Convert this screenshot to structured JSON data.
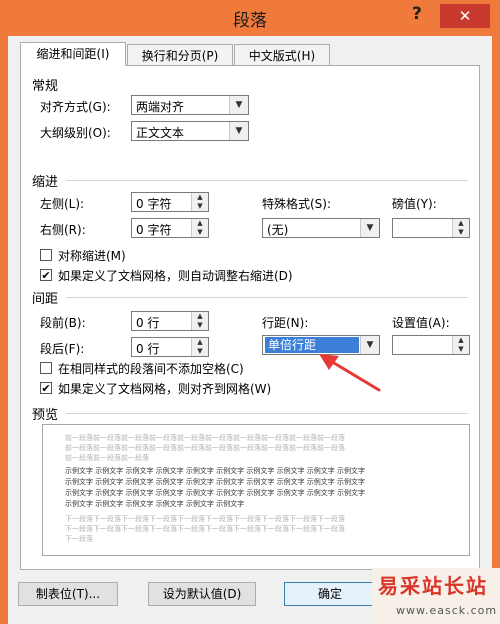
{
  "window": {
    "title": "段落",
    "help": "?",
    "close": "✕"
  },
  "tabs": [
    {
      "label": "缩进和间距(I)"
    },
    {
      "label": "换行和分页(P)"
    },
    {
      "label": "中文版式(H)"
    }
  ],
  "general": {
    "heading": "常规",
    "alignment_label": "对齐方式(G):",
    "alignment_value": "两端对齐",
    "outline_label": "大纲级别(O):",
    "outline_value": "正文文本"
  },
  "indent": {
    "heading": "缩进",
    "left_label": "左侧(L):",
    "left_value": "0 字符",
    "right_label": "右侧(R):",
    "right_value": "0 字符",
    "special_label": "特殊格式(S):",
    "special_value": "(无)",
    "by_label": "磅值(Y):",
    "by_value": "",
    "mirror_label": "对称缩进(M)",
    "mirror_checked": false,
    "auto_adjust_label": "如果定义了文档网格，则自动调整右缩进(D)",
    "auto_adjust_checked": true
  },
  "spacing": {
    "heading": "间距",
    "before_label": "段前(B):",
    "before_value": "0 行",
    "after_label": "段后(F):",
    "after_value": "0 行",
    "line_label": "行距(N):",
    "line_value": "单倍行距",
    "at_label": "设置值(A):",
    "at_value": "",
    "no_space_label": "在相同样式的段落间不添加空格(C)",
    "no_space_checked": false,
    "snap_grid_label": "如果定义了文档网格，则对齐到网格(W)",
    "snap_grid_checked": true
  },
  "preview": {
    "heading": "预览",
    "prev_lines": [
      "前一段落前一段落前一段落前一段落前一段落前一段落前一段落前一段落前一段落前一段落",
      "前一段落前一段落前一段落前一段落前一段落前一段落前一段落前一段落前一段落前一段落",
      "前一段落前一段落前一段落"
    ],
    "sample_lines": [
      "示例文字 示例文字 示例文字 示例文字 示例文字 示例文字 示例文字 示例文字 示例文字 示例文字",
      "示例文字 示例文字 示例文字 示例文字 示例文字 示例文字 示例文字 示例文字 示例文字 示例文字",
      "示例文字 示例文字 示例文字 示例文字 示例文字 示例文字 示例文字 示例文字 示例文字 示例文字",
      "示例文字 示例文字 示例文字 示例文字 示例文字 示例文字"
    ],
    "next_lines": [
      "下一段落下一段落下一段落下一段落下一段落下一段落下一段落下一段落下一段落下一段落",
      "下一段落下一段落下一段落下一段落下一段落下一段落下一段落下一段落下一段落下一段落",
      "下一段落"
    ]
  },
  "buttons": {
    "tabs": "制表位(T)...",
    "default": "设为默认值(D)",
    "ok": "确定"
  },
  "watermark": {
    "main": "易采站长站",
    "url": "www.easck.com"
  },
  "colors": {
    "titlebar": "#f07a3c",
    "close": "#c83a2d",
    "selection": "#3b7fd8",
    "arrow": "#e53935"
  }
}
